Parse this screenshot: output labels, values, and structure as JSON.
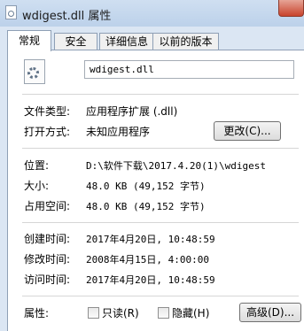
{
  "window": {
    "title": "wdigest.dll 属性"
  },
  "tabs": [
    {
      "label": "常规"
    },
    {
      "label": "安全"
    },
    {
      "label": "详细信息"
    },
    {
      "label": "以前的版本"
    }
  ],
  "general": {
    "file_name": "wdigest.dll",
    "file_type": {
      "label": "文件类型:",
      "value": "应用程序扩展 (.dll)"
    },
    "opens_with": {
      "label": "打开方式:",
      "value": "未知应用程序",
      "button": "更改(C)..."
    },
    "location": {
      "label": "位置:",
      "value": "D:\\软件下载\\2017.4.20(1)\\wdigest"
    },
    "size": {
      "label": "大小:",
      "value": "48.0 KB (49,152 字节)"
    },
    "size_on_disk": {
      "label": "占用空间:",
      "value": "48.0 KB (49,152 字节)"
    },
    "created": {
      "label": "创建时间:",
      "value": "2017年4月20日, 10:48:59"
    },
    "modified": {
      "label": "修改时间:",
      "value": "2008年4月15日, 4:00:00"
    },
    "accessed": {
      "label": "访问时间:",
      "value": "2017年4月20日, 10:48:59"
    },
    "attributes": {
      "label": "属性:",
      "readonly": {
        "label": "只读(R)",
        "checked": false
      },
      "hidden": {
        "label": "隐藏(H)",
        "checked": false
      },
      "advanced_button": "高级(D)..."
    }
  },
  "icons": {
    "window": "file-icon",
    "file": "dll-gear-icon",
    "close": "close-icon"
  }
}
